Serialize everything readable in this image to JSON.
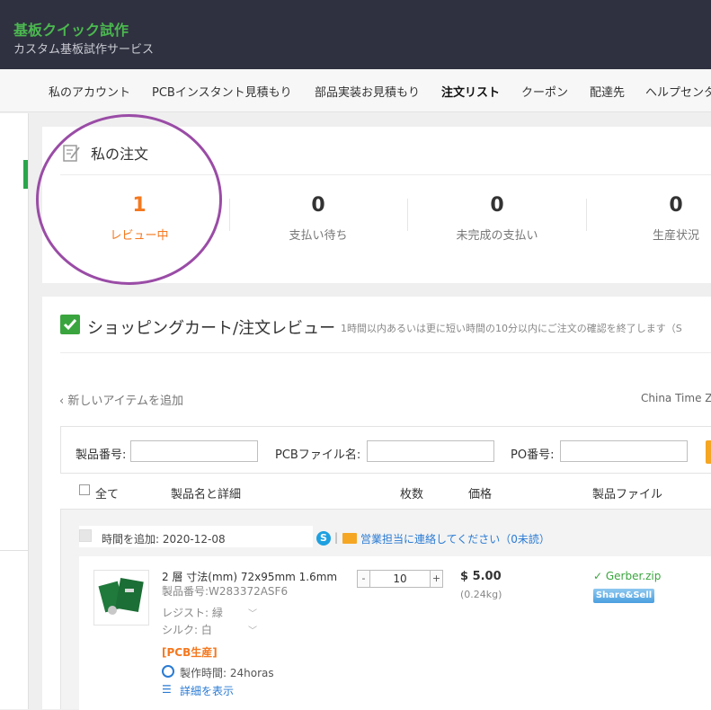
{
  "header": {
    "brand_title": "基板クイック試作",
    "brand_subtitle": "カスタム基板試作サービス"
  },
  "nav": {
    "items": [
      {
        "label": "私のアカウント"
      },
      {
        "label": "PCBインスタント見積もり"
      },
      {
        "label": "部品実装お見積もり"
      },
      {
        "label": "注文リスト",
        "active": true
      },
      {
        "label": "クーポン"
      },
      {
        "label": "配達先"
      },
      {
        "label": "ヘルプセンター"
      }
    ]
  },
  "orders": {
    "title": "私の注文",
    "stats": [
      {
        "count": "1",
        "label": "レビュー中",
        "active": true
      },
      {
        "count": "0",
        "label": "支払い待ち"
      },
      {
        "count": "0",
        "label": "未完成の支払い"
      },
      {
        "count": "0",
        "label": "生産状況"
      }
    ]
  },
  "cart": {
    "title": "ショッピングカート/注文レビュー",
    "subtitle": "1時間以内あるいは更に短い時間の10分以内にご注文の確認を終了します（S",
    "add_item_link": "‹ 新しいアイテムを追加",
    "time_zone": "China Time Zo",
    "filters": {
      "product_number_label": "製品番号:",
      "pcb_file_label": "PCBファイル名:",
      "po_label": "PO番号:",
      "product_number_value": "",
      "pcb_file_value": "",
      "po_value": ""
    },
    "columns": {
      "all": "全て",
      "name": "製品名と詳細",
      "qty": "枚数",
      "price": "価格",
      "file": "製品ファイル"
    },
    "group": {
      "date_label": "時間を追加: 2020-12-08",
      "contact_link": "営業担当に連絡してください（0未読）"
    },
    "item": {
      "spec_line1": "2 層 寸法(mm) 72x95mm 1.6mm",
      "product_no": "製品番号:W283372ASF6",
      "resist_label": "レジスト: 緑",
      "silk_label": "シルク: 白",
      "tag": "[PCB生産]",
      "lead_time": "製作時間: 24horas",
      "details_link": "詳細を表示",
      "qty": "10",
      "qty_minus": "-",
      "qty_plus": "+",
      "price": "$ 5.00",
      "weight": "(0.24kg)",
      "file_name": "Gerber.zip",
      "share_label": "Share&Sell"
    }
  },
  "colors": {
    "brand_green": "#4bb84f",
    "accent_orange": "#f5781e",
    "link_blue": "#2a7bd4",
    "header_bg": "#2f3140",
    "annotation_purple": "#9a4ca6"
  }
}
